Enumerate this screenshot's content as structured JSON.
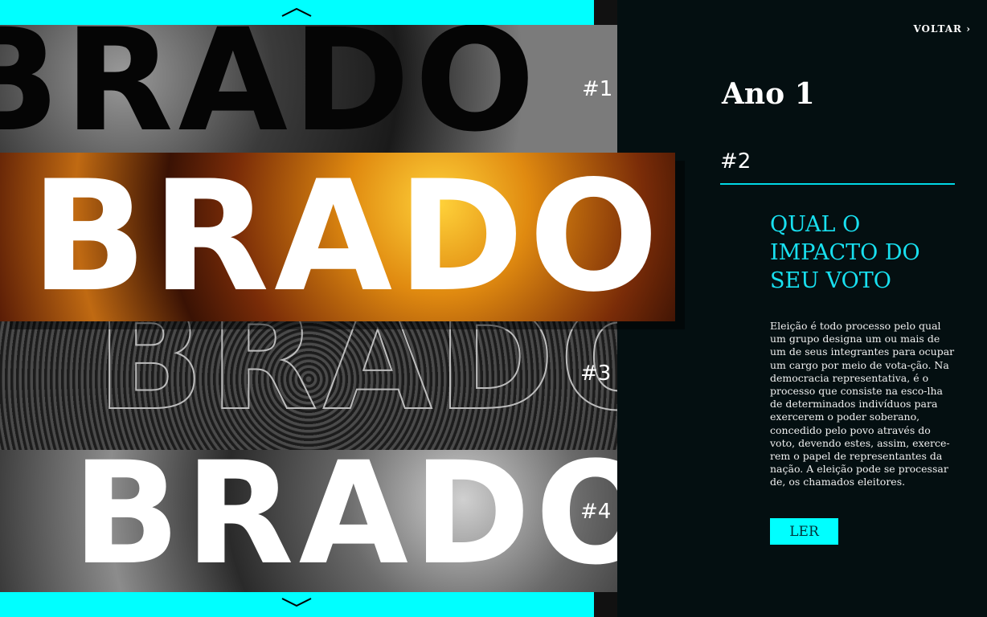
{
  "nav": {
    "back_label": "VOLTAR ›",
    "prev_icon": "chevron-up-icon",
    "next_icon": "chevron-down-icon"
  },
  "stack": {
    "word": "BRADO",
    "items": [
      {
        "number": "#1"
      },
      {
        "number": "#2"
      },
      {
        "number": "#3"
      },
      {
        "number": "#4"
      }
    ]
  },
  "article": {
    "year": "Ano 1",
    "issue": "#2",
    "headline": "QUAL O IMPACTO DO SEU VOTO",
    "body": "Eleição é todo processo pelo qual um grupo designa um ou mais de um de seus integrantes para ocupar um cargo por meio de vota-ção. Na democracia representativa, é o processo que consiste na esco-lha de determinados indivíduos para exercerem o poder soberano, concedido pelo povo através do voto, devendo estes, assim, exerce-rem o papel de representantes da nação. A eleição pode se processar de, os chamados eleitores.",
    "read_label": "LER"
  },
  "colors": {
    "accent": "#00ffff",
    "background": "#040f11"
  }
}
